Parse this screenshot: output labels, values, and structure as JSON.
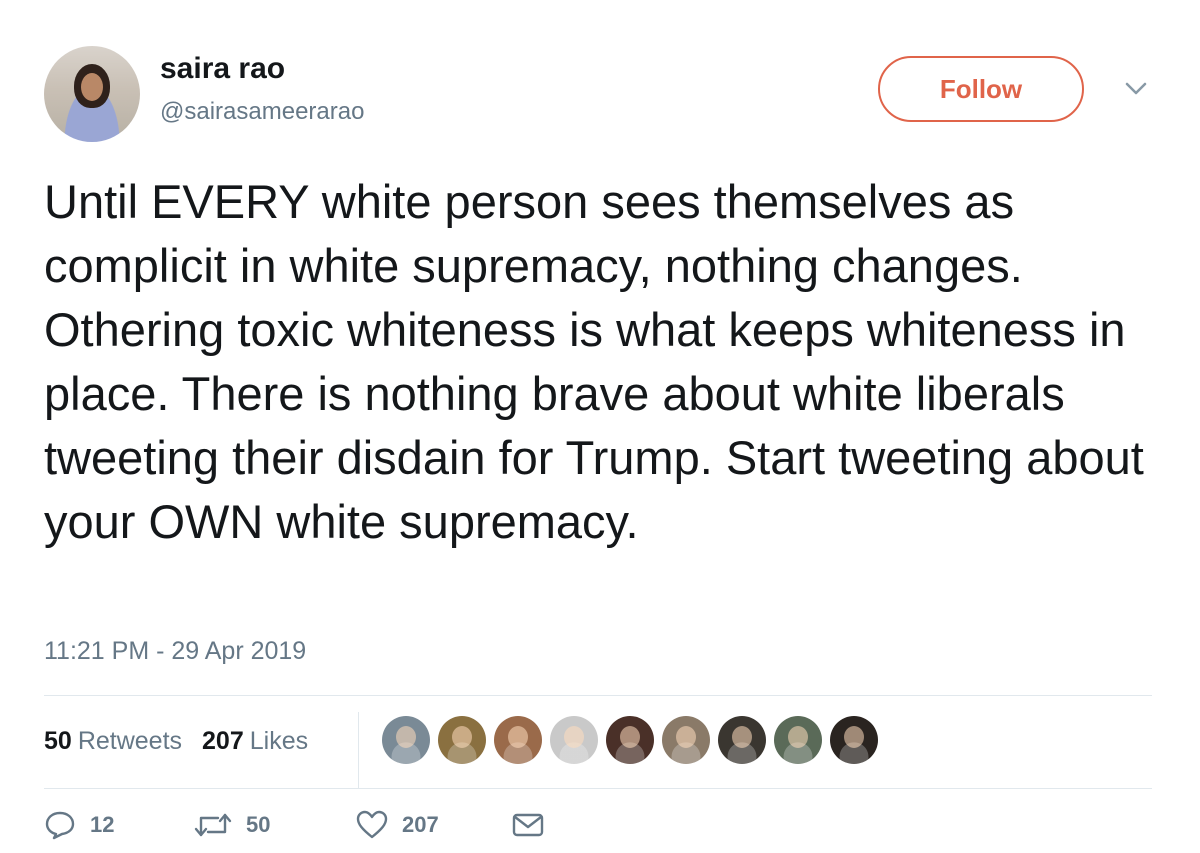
{
  "user": {
    "name": "saira rao",
    "handle": "@sairasameerarao"
  },
  "follow_label": "Follow",
  "tweet": {
    "text": "Until EVERY white person sees themselves as complicit in white supremacy, nothing changes. Othering toxic whiteness is what keeps whiteness in place. There is nothing brave about white liberals tweeting their disdain for Trump. Start tweeting about your OWN white supremacy.",
    "timestamp": "11:21 PM - 29 Apr 2019"
  },
  "stats": {
    "retweets_count": "50",
    "retweets_label": "Retweets",
    "likes_count": "207",
    "likes_label": "Likes"
  },
  "likers": [
    {
      "color": "#7a8a96"
    },
    {
      "color": "#8a7040"
    },
    {
      "color": "#9a6a4a"
    },
    {
      "color": "#c9c9c9"
    },
    {
      "color": "#4a3028"
    },
    {
      "color": "#8a7a68"
    },
    {
      "color": "#3a3630"
    },
    {
      "color": "#5a6a58"
    },
    {
      "color": "#2a2420"
    }
  ],
  "actions": {
    "reply_count": "12",
    "retweet_count": "50",
    "like_count": "207"
  },
  "colors": {
    "accent": "#e0644a",
    "secondary_text": "#657786",
    "divider": "#e1e8ed"
  }
}
